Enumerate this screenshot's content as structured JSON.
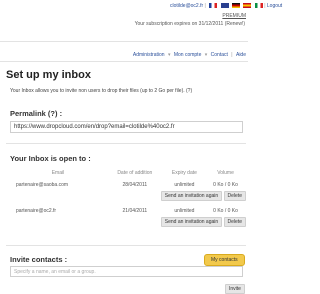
{
  "header": {
    "user_email": "clotilde@oc2.fr",
    "logout": "Logout",
    "premium": "PREMIUM",
    "subscription": "Your subscription expires on 31/12/2011 (Renew!)",
    "language_flags": [
      "french-flag-icon",
      "english-flag-icon",
      "german-flag-icon",
      "spanish-flag-icon",
      "italian-flag-icon"
    ]
  },
  "nav": {
    "items": [
      "Administration",
      "Mon compte",
      "Contact",
      "Aide"
    ]
  },
  "page": {
    "title": "Set up my inbox",
    "intro": "Your Inbox allows you to invite non users to drop their files (up to 2 Go per file). (?)"
  },
  "permalink": {
    "label": "Permalink (?) :",
    "value": "https://www.dropcloud.com/en/drop?email=clotilde%40oc2.fr"
  },
  "inbox_open": {
    "label": "Your Inbox is open to :",
    "columns": [
      "Email",
      "Date of addition",
      "Expiry date",
      "Volume"
    ],
    "rows": [
      {
        "email": "partenaire@saoba.com",
        "date": "28/04/2011",
        "expiry": "unlimited",
        "volume": "0 Ko / 0 Ko"
      },
      {
        "email": "partenaire@oc2.fr",
        "date": "21/04/2011",
        "expiry": "unlimited",
        "volume": "0 Ko / 0 Ko"
      }
    ],
    "send_again": "Send an invitation again",
    "delete": "Delete"
  },
  "invite": {
    "label": "Invite contacts :",
    "my_contacts": "My contacts",
    "placeholder": "Specify a name, an email or a group.",
    "invite_button": "Invite"
  },
  "colors": {
    "link": "#2a4f9a",
    "accent_yellow": "#f2c94c",
    "border": "#cfcfcf"
  }
}
